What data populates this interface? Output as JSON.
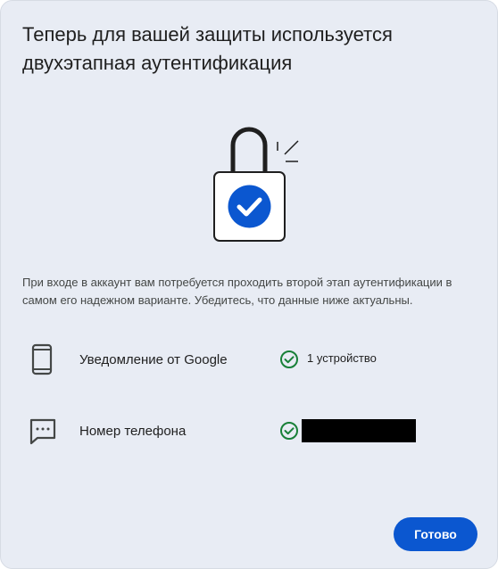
{
  "dialog": {
    "title": "Теперь для вашей защиты используется двухэтапная аутентификация",
    "description": "При входе в аккаунт вам потребуется проходить второй этап аутентификации в самом его надежном варианте. Убедитесь, что данные ниже актуальны.",
    "illustration_icon": "lock-check-illustration",
    "methods": [
      {
        "icon": "smartphone-icon",
        "label": "Уведомление от Google",
        "status_icon": "check-circle-icon",
        "status": "1 устройство"
      },
      {
        "icon": "sms-message-icon",
        "label": "Номер телефона",
        "status_icon": "check-circle-icon",
        "status": ""
      }
    ],
    "done_label": "Готово"
  },
  "colors": {
    "dialog_background": "#e8ecf4",
    "accent_blue": "#0b57d0",
    "check_green": "#188038",
    "text_primary": "#1f1f1f",
    "text_secondary": "#444746"
  }
}
